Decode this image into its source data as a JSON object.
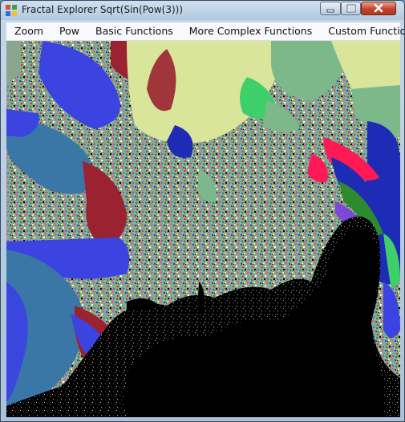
{
  "window": {
    "title": "Fractal Explorer Sqrt(Sin(Pow(3)))",
    "icon": "app-icon",
    "controls": [
      "minimize-icon",
      "maximize-icon",
      "close-icon"
    ]
  },
  "menu": {
    "items": [
      {
        "label": "Zoom"
      },
      {
        "label": "Pow"
      },
      {
        "label": "Basic Functions"
      },
      {
        "label": "More Complex Functions"
      },
      {
        "label": "Custom Function"
      }
    ]
  },
  "fractal": {
    "palette": [
      "#3a76a6",
      "#3b43e0",
      "#1d2bb5",
      "#9b2230",
      "#d8e59a",
      "#7cb88a",
      "#3fcf6a",
      "#ff1a55",
      "#2e8a2e",
      "#000000"
    ]
  }
}
